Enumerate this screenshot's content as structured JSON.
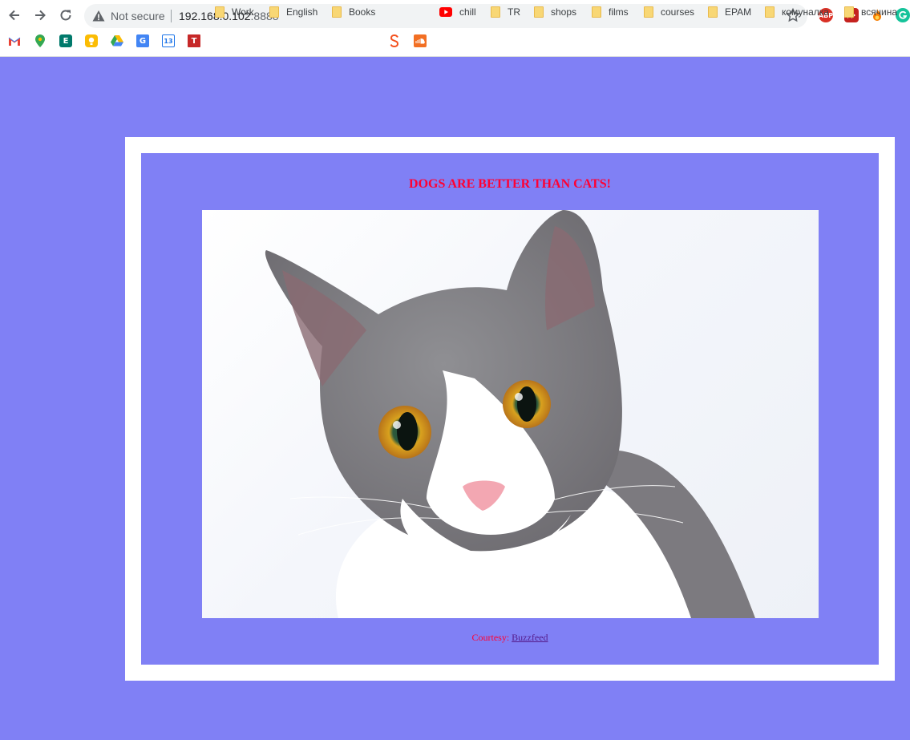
{
  "browser": {
    "security_label": "Not secure",
    "url_host": "192.168.0.102",
    "url_port": ":8888"
  },
  "bookmarks": [
    {
      "label": "Work",
      "type": "folder"
    },
    {
      "label": "English",
      "type": "folder"
    },
    {
      "label": "Books",
      "type": "folder"
    },
    {
      "label": "chill",
      "type": "site"
    },
    {
      "label": "TR",
      "type": "folder"
    },
    {
      "label": "shops",
      "type": "folder"
    },
    {
      "label": "films",
      "type": "folder"
    },
    {
      "label": "courses",
      "type": "folder"
    },
    {
      "label": "EPAM",
      "type": "folder"
    },
    {
      "label": "комуналка",
      "type": "folder"
    },
    {
      "label": "всячина",
      "type": "folder"
    }
  ],
  "extensions": {
    "abp": "ABP"
  },
  "bookmark_icons": {
    "calendar_day": "13"
  },
  "page": {
    "headline": "DOGS ARE BETTER THAN CATS!",
    "courtesy_prefix": "Courtesy: ",
    "courtesy_link": "Buzzfeed",
    "background_color": "#8080f5",
    "accent_color": "#ff0033"
  }
}
